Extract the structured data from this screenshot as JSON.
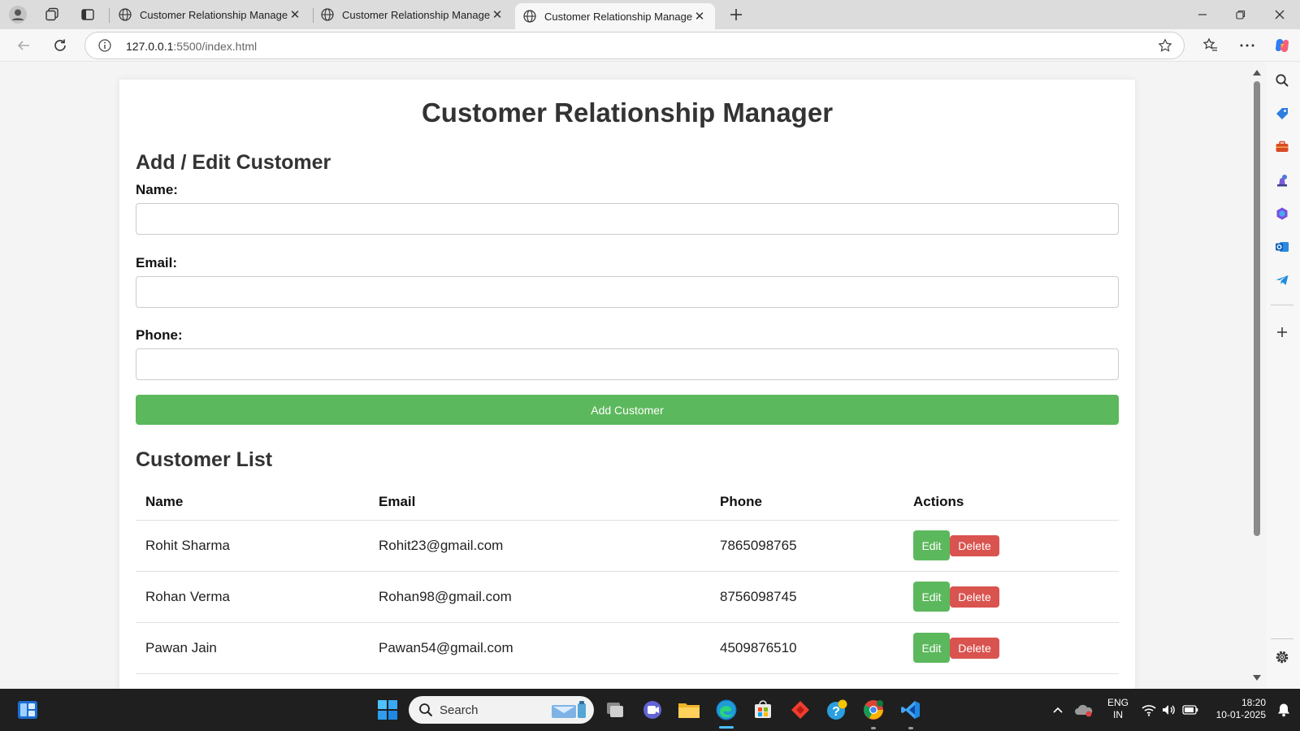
{
  "browser": {
    "tabs": [
      {
        "title": "Customer Relationship Manager",
        "active": false
      },
      {
        "title": "Customer Relationship Manager",
        "active": false
      },
      {
        "title": "Customer Relationship Manager",
        "active": true
      }
    ],
    "url_host": "127.0.0.1",
    "url_rest": ":5500/index.html",
    "icons": [
      "profile-icon",
      "workspaces-icon",
      "tab-actions-icon",
      "new-tab-icon",
      "minimize-icon",
      "restore-icon",
      "close-window-icon",
      "back-icon",
      "refresh-icon",
      "site-info-icon",
      "favorite-star-icon",
      "favorites-icon",
      "more-icon",
      "copilot-icon"
    ]
  },
  "edge_sidebar": {
    "icons": [
      "search-icon",
      "shopping-icon",
      "tools-icon",
      "games-icon",
      "office-icon",
      "outlook-icon",
      "telegram-icon",
      "add-icon",
      "settings-icon"
    ]
  },
  "page": {
    "title": "Customer Relationship Manager",
    "form": {
      "heading": "Add / Edit Customer",
      "name_label": "Name:",
      "name_value": "",
      "email_label": "Email:",
      "email_value": "",
      "phone_label": "Phone:",
      "phone_value": "",
      "submit_label": "Add Customer"
    },
    "list": {
      "heading": "Customer List",
      "columns": [
        "Name",
        "Email",
        "Phone",
        "Actions"
      ],
      "rows": [
        {
          "name": "Rohit Sharma",
          "email": "Rohit23@gmail.com",
          "phone": "7865098765"
        },
        {
          "name": "Rohan Verma",
          "email": "Rohan98@gmail.com",
          "phone": "8756098745"
        },
        {
          "name": "Pawan Jain",
          "email": "Pawan54@gmail.com",
          "phone": "4509876510"
        }
      ],
      "edit_label": "Edit",
      "delete_label": "Delete"
    }
  },
  "taskbar": {
    "search_label": "Search",
    "lang_line1": "ENG",
    "lang_line2": "IN",
    "time": "18:20",
    "date": "10-01-2025",
    "apps": [
      "start-icon",
      "task-view-icon",
      "teams-icon",
      "file-explorer-icon",
      "edge-icon",
      "store-icon",
      "anydesk-icon",
      "help-icon",
      "chrome-icon",
      "vscode-icon"
    ]
  },
  "colors": {
    "primary_green": "#5cb85c",
    "danger_red": "#d9534f",
    "page_bg": "#f4f4f4",
    "taskbar_bg": "#1f1f1f"
  }
}
